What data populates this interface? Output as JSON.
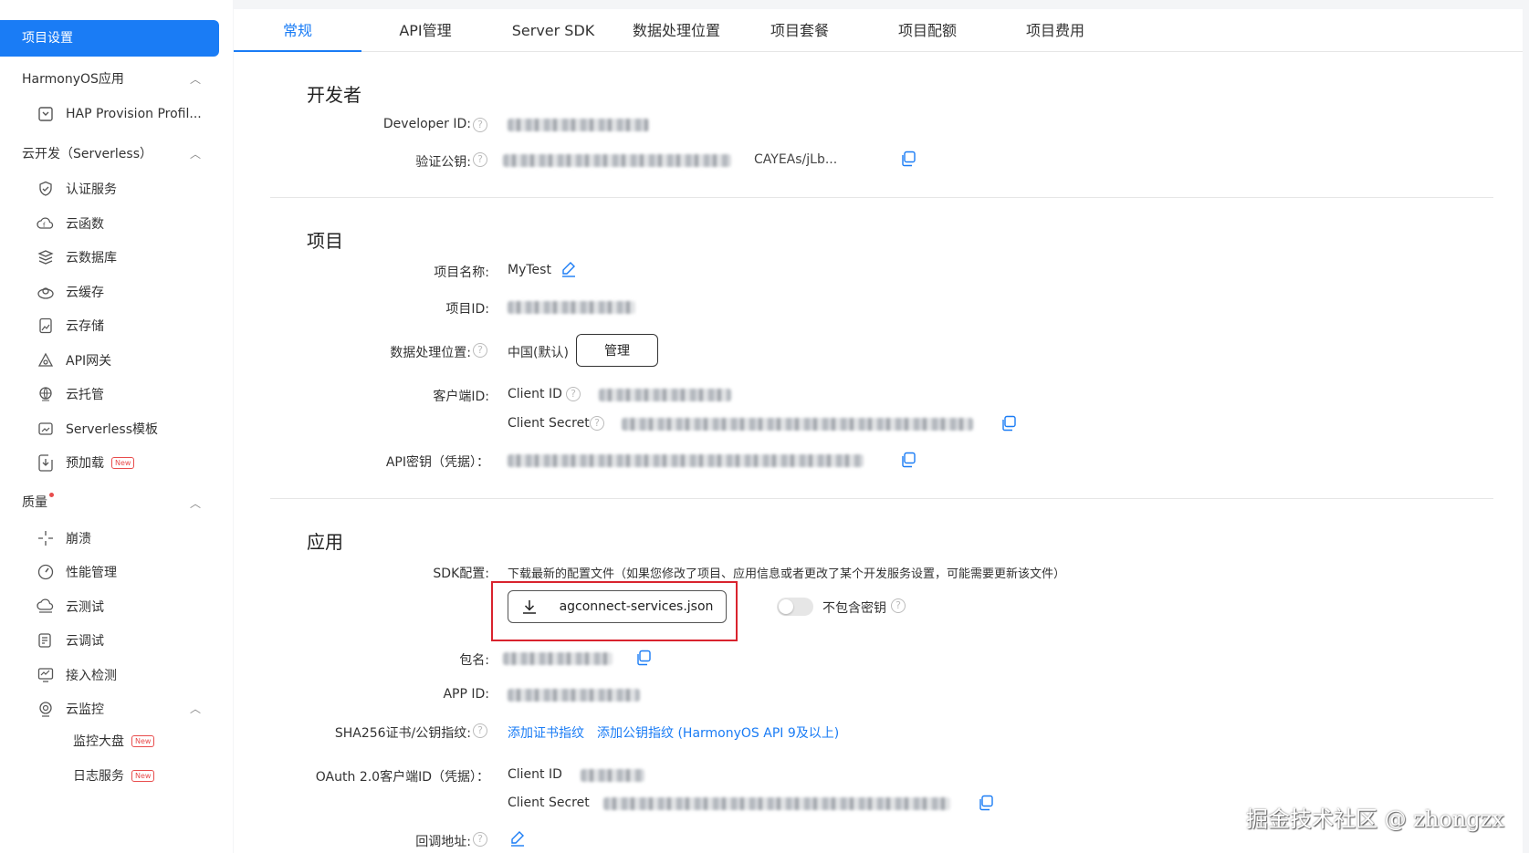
{
  "sidebar": {
    "active": "项目设置",
    "groups": {
      "harmony": "HarmonyOS应用",
      "serverless": "云开发（Serverless）",
      "quality": "质量"
    },
    "items": {
      "hap": "HAP Provision Profil...",
      "auth": "认证服务",
      "functions": "云函数",
      "database": "云数据库",
      "cache": "云缓存",
      "storage": "云存储",
      "apigw": "API网关",
      "hosting": "云托管",
      "template": "Serverless模板",
      "preload": "预加载",
      "crash": "崩溃",
      "perf": "性能管理",
      "test": "云测试",
      "debug": "云调试",
      "access": "接入检测",
      "monitor": "云监控",
      "dashboard": "监控大盘",
      "logs": "日志服务"
    },
    "new_badge": "New"
  },
  "tabs": [
    "常规",
    "API管理",
    "Server SDK",
    "数据处理位置",
    "项目套餐",
    "项目配额",
    "项目费用"
  ],
  "developer": {
    "title": "开发者",
    "developer_id_label": "Developer ID:",
    "pubkey_label": "验证公钥:",
    "pubkey_tail": "CAYEAs/jLb..."
  },
  "project": {
    "title": "项目",
    "name_label": "项目名称:",
    "name_value": "MyTest",
    "id_label": "项目ID:",
    "location_label": "数据处理位置:",
    "location_value": "中国(默认)",
    "manage_button": "管理",
    "client_label": "客户端ID:",
    "client_id_label": "Client ID",
    "client_secret_label": "Client Secret",
    "api_key_label": "API密钥（凭据）："
  },
  "app": {
    "title": "应用",
    "sdk_label": "SDK配置:",
    "sdk_desc": "下载最新的配置文件（如果您修改了项目、应用信息或者更改了某个开发服务设置，可能需要更新该文件）",
    "download_button": "agconnect-services.json",
    "exclude_key_label": "不包含密钥",
    "package_label": "包名:",
    "appid_label": "APP ID:",
    "sha_label": "SHA256证书/公钥指纹:",
    "add_cert_link": "添加证书指纹",
    "add_pubkey_link": "添加公钥指纹 (HarmonyOS API 9及以上)",
    "oauth_label": "OAuth 2.0客户端ID（凭据）：",
    "oauth_client_id": "Client ID",
    "oauth_client_secret": "Client Secret",
    "callback_label": "回调地址:"
  },
  "watermark": "掘金技术社区 @ zhongzx",
  "colors": {
    "accent": "#1a7cf5",
    "highlight": "#d9232e"
  }
}
